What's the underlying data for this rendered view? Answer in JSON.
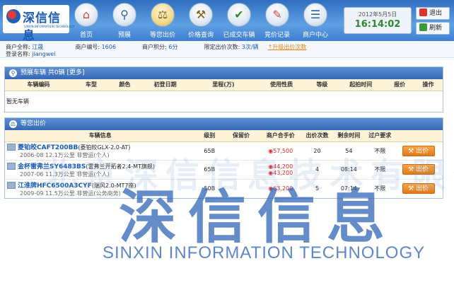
{
  "brand": {
    "name": "深信信息",
    "sub": "SINXIN INFORMATION TECHNOLOGY"
  },
  "nav": [
    {
      "label": "首页",
      "icon": "home-icon",
      "glyph": "⌂"
    },
    {
      "label": "预展",
      "icon": "magnifier-icon",
      "glyph": "⚲"
    },
    {
      "label": "等您出价",
      "icon": "gavel-icon",
      "glyph": "⚖"
    },
    {
      "label": "价格查询",
      "icon": "auction-hammer-icon",
      "glyph": "⚒"
    },
    {
      "label": "已成交车辆",
      "icon": "check-icon",
      "glyph": "✔"
    },
    {
      "label": "竞价记录",
      "icon": "record-icon",
      "glyph": "✎"
    },
    {
      "label": "商户中心",
      "icon": "profile-card-icon",
      "glyph": "☰"
    }
  ],
  "clock": {
    "date": "2012年5月5日",
    "time": "16:14:02"
  },
  "actions": {
    "logout": "退出",
    "refresh": "刷新"
  },
  "merchant": {
    "fullname_label": "商户全称:",
    "fullname": "江晟",
    "id_label": "商户编号:",
    "id": "1606",
    "points_label": "商户积分:",
    "points": "6分",
    "limit_label": "限定出价次数:",
    "limit": "3次/辆",
    "upgrade": "升级出价次数",
    "login_label": "登录名称:",
    "login": "jiangwei"
  },
  "preview": {
    "title": "预展车辆 共0辆",
    "more": "[更多]",
    "columns": [
      "车辆编码",
      "车型",
      "颜色",
      "初登日期",
      "里程(万)",
      "使用性质",
      "等级",
      "起拍时间",
      "报价",
      "操作"
    ],
    "empty": "暂无车辆"
  },
  "bidding": {
    "title": "等您出价",
    "columns": [
      "车辆信息",
      "级别",
      "保留价",
      "商户合手价",
      "出价次数",
      "剩余时间",
      "过户要求"
    ],
    "rows": [
      {
        "name": "菱铂皎CAFT200BB",
        "model": "(菱铂皎GLX-2.0-AT)",
        "date": "2006-08",
        "mileage": "12.1万公里",
        "usage": "非营运(个人)",
        "level": "65B",
        "reserve": "",
        "price": "57,500",
        "count": "20",
        "remaining": "54",
        "transfer": "不限",
        "bid": "出价"
      },
      {
        "name": "金杯雷弗兰SY6483BS",
        "model": "(雷弗兰开拓者2.4-MT旗舰)",
        "date": "2007-06",
        "mileage": "11.3万公里",
        "usage": "非营运(个人)",
        "level": "65B",
        "reserve": "",
        "price": "44,200",
        "price2": "43,200",
        "count": "4",
        "remaining": "08:14",
        "transfer": "不限",
        "bid": "出价"
      },
      {
        "name": "江淮牌HFC6500A3CYF",
        "model": "(瑞风2.0-MT7座)",
        "date": "2009-09",
        "mileage": "11.5万公里",
        "usage": "非营运(公务商务)",
        "level": "50B",
        "reserve": "",
        "price": "63,200",
        "count": "5",
        "remaining": "07:14",
        "transfer": "不限",
        "bid": "出价"
      }
    ]
  },
  "watermark": {
    "big": "深信信息",
    "faint": "北京深信信息技术有限公",
    "en": "SINXIN INFORMATION TECHNOLOGY"
  }
}
